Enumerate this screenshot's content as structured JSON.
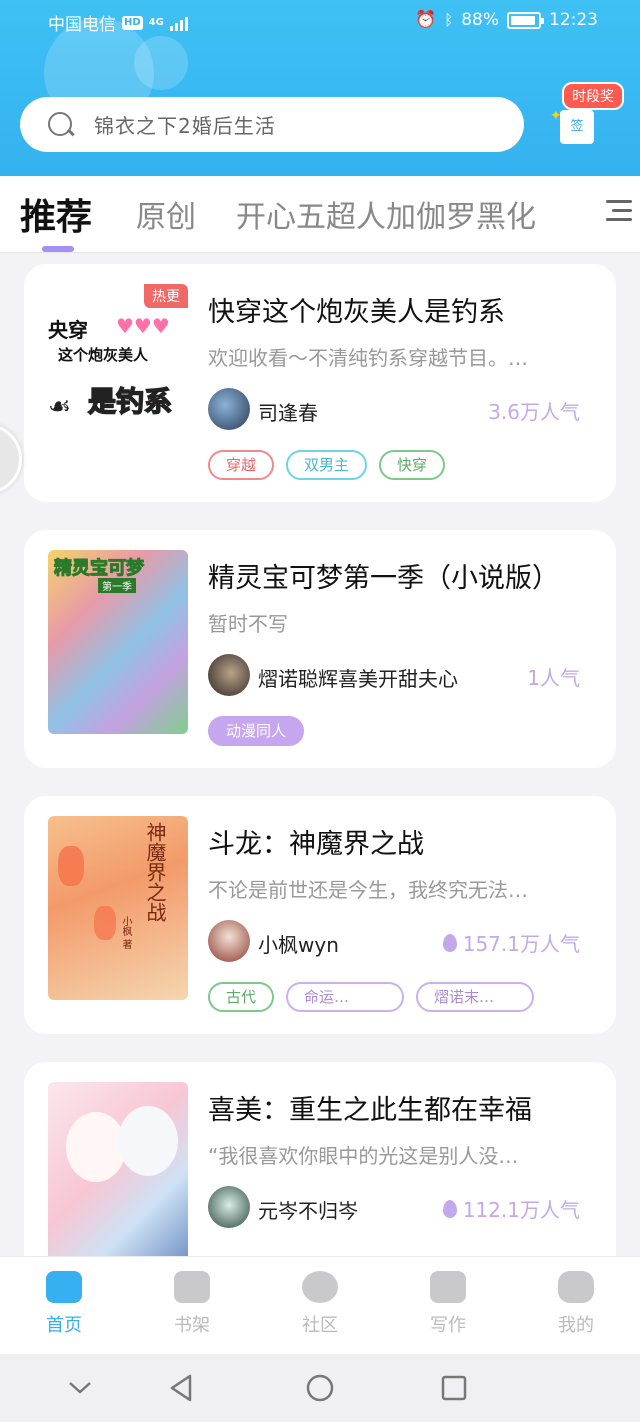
{
  "status_bar": {
    "carrier": "中国电信",
    "hd": "HD",
    "network": "4G",
    "battery": "88%",
    "time": "12:23"
  },
  "search": {
    "placeholder": "锦衣之下2婚后生活"
  },
  "sign_in": {
    "badge": "时段奖",
    "box": "签"
  },
  "tabs": [
    {
      "label": "推荐",
      "active": true
    },
    {
      "label": "原创",
      "active": false
    },
    {
      "label": "开心五超人加伽罗黑化",
      "active": false
    }
  ],
  "books": [
    {
      "title": "快穿这个炮灰美人是钓系",
      "desc": "欢迎收看～不清纯钓系穿越节目。…",
      "author": "司逢春",
      "popularity": "3.6万人气",
      "hot": "热更",
      "cover_text": [
        "央穿",
        "这个炮灰美人",
        "是钓系"
      ],
      "tags": [
        {
          "label": "穿越",
          "style": "red"
        },
        {
          "label": "双男主",
          "style": "cyan"
        },
        {
          "label": "快穿",
          "style": "green"
        }
      ]
    },
    {
      "title": "精灵宝可梦第一季（小说版）",
      "desc": "暂时不写",
      "author": "熠诺聪辉喜美开甜夫心",
      "popularity": "1人气",
      "cover_text": [
        "精灵宝可梦",
        "第一季"
      ],
      "tags": [
        {
          "label": "动漫同人",
          "style": "purple-fill"
        }
      ]
    },
    {
      "title": "斗龙：神魔界之战",
      "desc": "不论是前世还是今生，我终究无法…",
      "author": "小枫wyn",
      "popularity": "157.1万人气",
      "cover_text": [
        "神魔界之战",
        "小枫 著"
      ],
      "tags": [
        {
          "label": "古代",
          "style": "green"
        },
        {
          "label": "命运…",
          "style": "purple"
        },
        {
          "label": "熠诺末…",
          "style": "purple"
        }
      ]
    },
    {
      "title": "喜美：重生之此生都在幸福",
      "desc": "“我很喜欢你眼中的光这是别人没…",
      "author": "元岑不归岑",
      "popularity": "112.1万人气"
    }
  ],
  "bottom_nav": [
    {
      "label": "首页",
      "icon": "home-icon",
      "active": true
    },
    {
      "label": "书架",
      "icon": "bookshelf-icon",
      "active": false
    },
    {
      "label": "社区",
      "icon": "community-icon",
      "active": false
    },
    {
      "label": "写作",
      "icon": "write-icon",
      "active": false
    },
    {
      "label": "我的",
      "icon": "profile-icon",
      "active": false
    }
  ],
  "colors": {
    "header": "#3fc1f4",
    "accent": "#36b0f0",
    "tab_underline": "#a58ff0",
    "popularity": "#c3a9ea"
  }
}
